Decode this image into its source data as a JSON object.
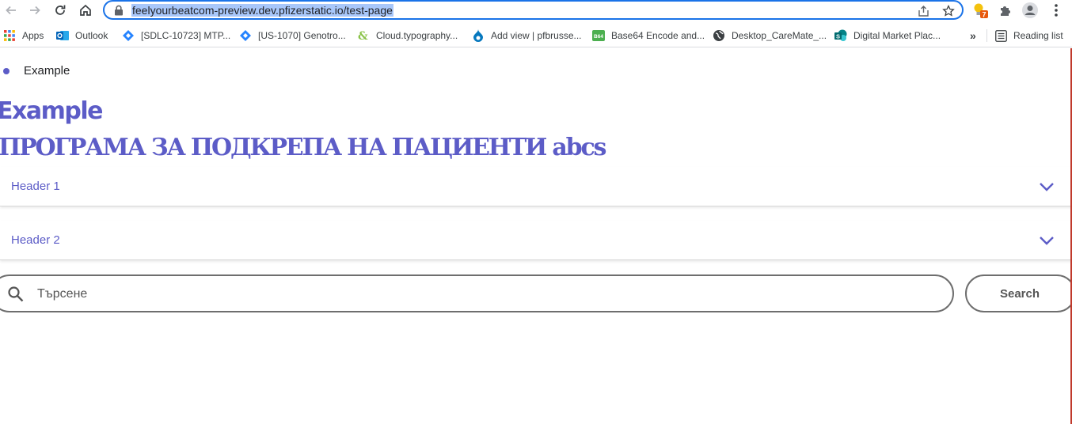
{
  "browser": {
    "url": "feelyourbeatcom-preview.dev.pfizerstatic.io/test-page",
    "extension_badge": "7",
    "colors": {
      "omnibox_border": "#1a73e8",
      "url_highlight": "#a8c7fa",
      "badge": "#e8590c"
    }
  },
  "bookmarks": {
    "items": [
      {
        "label": "Apps",
        "icon": "apps-grid-icon"
      },
      {
        "label": "Outlook",
        "icon": "outlook-icon"
      },
      {
        "label": "[SDLC-10723] MTP...",
        "icon": "jira-icon"
      },
      {
        "label": "[US-1070] Genotro...",
        "icon": "jira-icon"
      },
      {
        "label": "Cloud.typography...",
        "icon": "typography-icon"
      },
      {
        "label": "Add view | pfbrusse...",
        "icon": "drupal-icon"
      },
      {
        "label": "Base64 Encode and...",
        "icon": "base64-icon"
      },
      {
        "label": "Desktop_CareMate_...",
        "icon": "globe-icon"
      },
      {
        "label": "Digital Market Plac...",
        "icon": "sharepoint-icon"
      }
    ],
    "overflow": "»",
    "reading_list": "Reading list"
  },
  "page": {
    "bullet_item": "Example",
    "heading": "Example",
    "subheading": "ПРОГРАМА ЗА ПОДКРЕПА НА ПАЦИЕНТИ abcs",
    "accordions": [
      {
        "label": "Header 1"
      },
      {
        "label": "Header 2"
      }
    ],
    "search": {
      "placeholder": "Търсене",
      "button_label": "Search"
    },
    "colors": {
      "accent": "#5c5cc7",
      "border": "#6e6e6e"
    }
  }
}
